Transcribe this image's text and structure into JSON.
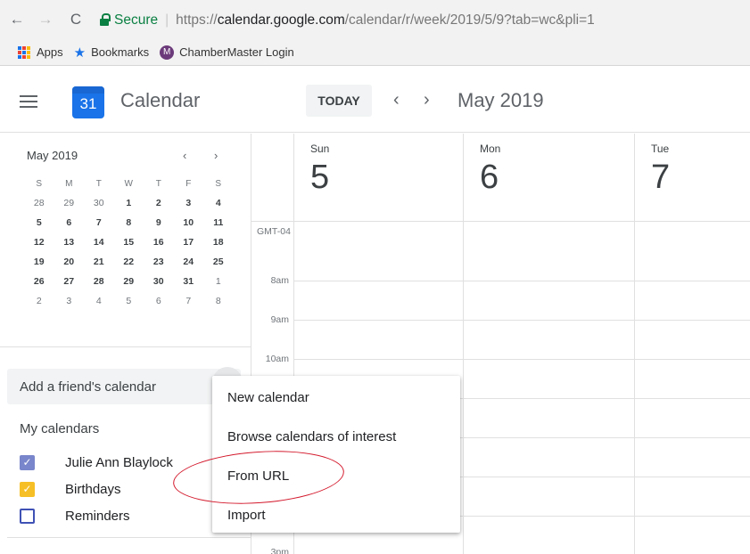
{
  "browser": {
    "secure_label": "Secure",
    "url_scheme": "https://",
    "url_host": "calendar.google.com",
    "url_path": "/calendar/r/week/2019/5/9?tab=wc&pli=1",
    "bookmarks": [
      "Apps",
      "Bookmarks",
      "ChamberMaster Login"
    ]
  },
  "header": {
    "app_title": "Calendar",
    "logo_day": "31",
    "today_label": "TODAY",
    "current_range": "May 2019"
  },
  "mini_calendar": {
    "title": "May 2019",
    "weekdays": [
      "S",
      "M",
      "T",
      "W",
      "T",
      "F",
      "S"
    ],
    "weeks": [
      [
        "28",
        "29",
        "30",
        "1",
        "2",
        "3",
        "4"
      ],
      [
        "5",
        "6",
        "7",
        "8",
        "9",
        "10",
        "11"
      ],
      [
        "12",
        "13",
        "14",
        "15",
        "16",
        "17",
        "18"
      ],
      [
        "19",
        "20",
        "21",
        "22",
        "23",
        "24",
        "25"
      ],
      [
        "26",
        "27",
        "28",
        "29",
        "30",
        "31",
        "1"
      ],
      [
        "2",
        "3",
        "4",
        "5",
        "6",
        "7",
        "8"
      ]
    ]
  },
  "sidebar": {
    "add_friend_placeholder": "Add a friend's calendar",
    "my_calendars_label": "My calendars",
    "calendars": [
      {
        "name": "Julie Ann Blaylock",
        "checked": true,
        "color": "#7986cb"
      },
      {
        "name": "Birthdays",
        "checked": true,
        "color": "#f6bf26"
      },
      {
        "name": "Reminders",
        "checked": false,
        "color": "#3f51b5"
      }
    ]
  },
  "week": {
    "days": [
      {
        "name": "Sun",
        "num": "5"
      },
      {
        "name": "Mon",
        "num": "6"
      },
      {
        "name": "Tue",
        "num": "7"
      }
    ],
    "timezone": "GMT-04",
    "times": [
      "8am",
      "9am",
      "10am",
      "3pm"
    ]
  },
  "menu": {
    "items": [
      "New calendar",
      "Browse calendars of interest",
      "From URL",
      "Import"
    ]
  }
}
